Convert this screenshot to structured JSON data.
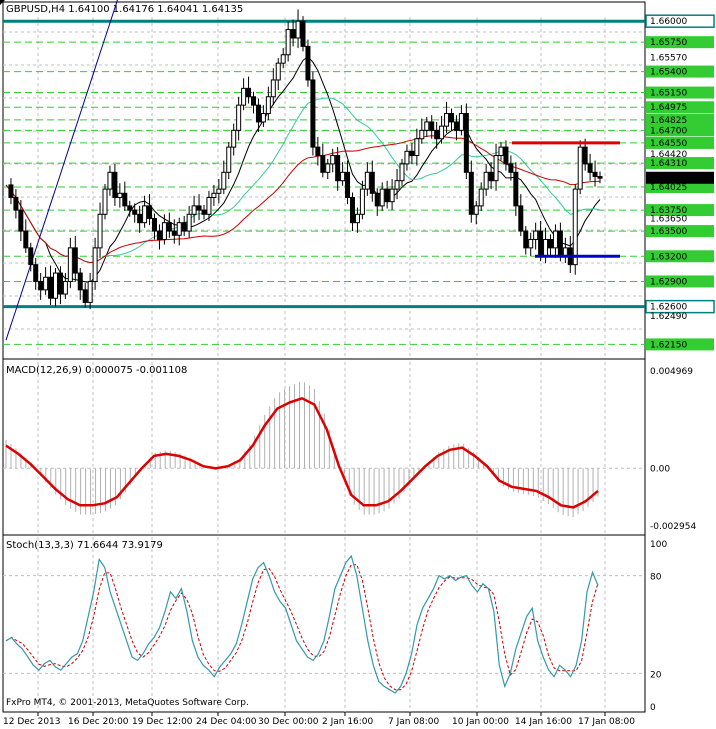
{
  "main": {
    "symbol": "GBPUSD,H4",
    "ohlc": "1.64100 1.64176 1.64041 1.64135",
    "current_price": "1.64135",
    "price_labels": [
      "1.66000",
      "1.65750",
      "1.65570",
      "1.65400",
      "1.65150",
      "1.64975",
      "1.64825",
      "1.64700",
      "1.64550",
      "1.64420",
      "1.64310",
      "1.64025",
      "1.63750",
      "1.63650",
      "1.63500",
      "1.63200",
      "1.62900",
      "1.62600",
      "1.62490",
      "1.62150"
    ],
    "levels": {
      "top_line": "1.66000",
      "bottom_line": "1.62600",
      "resistance": "1.64550",
      "support": "1.63200"
    }
  },
  "macd": {
    "title": "MACD(12,26,9) 0.000075 -0.001108",
    "labels": [
      "0.004969",
      "0.00",
      "-0.002954"
    ]
  },
  "stoch": {
    "title": "Stoch(13,3,3) 71.6644 73.9179",
    "labels": [
      "100",
      "80",
      "20",
      "0"
    ]
  },
  "footer": {
    "copyright": "FxPro MT4, © 2001-2013, MetaQuotes Software Corp."
  },
  "time_axis": [
    "12 Dec 2013",
    "16 Dec 20:00",
    "19 Dec 12:00",
    "24 Dec 04:00",
    "30 Dec 00:00",
    "2 Jan 16:00",
    "7 Jan 08:00",
    "10 Jan 00:00",
    "14 Jan 16:00",
    "17 Jan 08:00"
  ],
  "colors": {
    "grid": "#c0c0c0",
    "fibo": "#33cc33",
    "teal": "#008080",
    "resist": "#dd0000",
    "support": "#0000cc",
    "ma_black": "#000000",
    "ma_red": "#cc0000",
    "ma_green": "#33cc99",
    "ma_blue": "#000099",
    "macd_signal": "#dd0000",
    "stoch_main": "#3399aa",
    "stoch_signal": "#cc0000"
  },
  "chart_data": [
    {
      "type": "candlestick",
      "title": "GBPUSD,H4",
      "ylim": [
        1.62,
        1.6605
      ],
      "x": [
        "12 Dec 2013",
        "16 Dec 20:00",
        "19 Dec 12:00",
        "24 Dec 04:00",
        "30 Dec 00:00",
        "2 Jan 16:00",
        "7 Jan 08:00",
        "10 Jan 00:00",
        "14 Jan 16:00",
        "17 Jan 08:00"
      ],
      "close_path": [
        1.6405,
        1.639,
        1.6375,
        1.635,
        1.633,
        1.631,
        1.629,
        1.628,
        1.6295,
        1.627,
        1.63,
        1.6275,
        1.629,
        1.633,
        1.63,
        1.628,
        1.6265,
        1.629,
        1.633,
        1.637,
        1.64,
        1.642,
        1.639,
        1.6395,
        1.638,
        1.6375,
        1.637,
        1.636,
        1.638,
        1.6365,
        1.635,
        1.634,
        1.636,
        1.635,
        1.6345,
        1.636,
        1.635,
        1.637,
        1.638,
        1.6375,
        1.637,
        1.639,
        1.6395,
        1.64,
        1.642,
        1.645,
        1.647,
        1.65,
        1.652,
        1.651,
        1.65,
        1.648,
        1.649,
        1.651,
        1.653,
        1.655,
        1.656,
        1.659,
        1.658,
        1.66,
        1.657,
        1.653,
        1.645,
        1.644,
        1.642,
        1.643,
        1.644,
        1.641,
        1.642,
        1.639,
        1.636,
        1.637,
        1.64,
        1.642,
        1.6395,
        1.638,
        1.64,
        1.6385,
        1.64,
        1.641,
        1.643,
        1.6445,
        1.644,
        1.646,
        1.647,
        1.648,
        1.647,
        1.646,
        1.6475,
        1.649,
        1.648,
        1.647,
        1.649,
        1.642,
        1.637,
        1.638,
        1.64,
        1.642,
        1.641,
        1.644,
        1.645,
        1.643,
        1.642,
        1.638,
        1.635,
        1.633,
        1.634,
        1.635,
        1.632,
        1.634,
        1.633,
        1.635,
        1.632,
        1.633,
        1.631,
        1.64,
        1.645,
        1.643,
        1.642,
        1.6415,
        1.6413
      ]
    },
    {
      "type": "line",
      "title": "MACD(12,26,9) 0.000075 -0.001108",
      "ylim": [
        -0.00295,
        0.00497
      ],
      "signal": [
        0.0011,
        0.0007,
        0.0002,
        -0.0004,
        -0.001,
        -0.0015,
        -0.0018,
        -0.0018,
        -0.0017,
        -0.0014,
        -0.0007,
        0.0,
        0.0006,
        0.0007,
        0.0006,
        0.0004,
        0.0001,
        0.0,
        0.0001,
        0.0004,
        0.0011,
        0.0021,
        0.0029,
        0.0032,
        0.0034,
        0.0031,
        0.0019,
        0.0001,
        -0.0013,
        -0.0018,
        -0.0018,
        -0.0016,
        -0.0011,
        -0.0005,
        0.0001,
        0.0006,
        0.0009,
        0.001,
        0.0006,
        0.0001,
        -0.0006,
        -0.0009,
        -0.001,
        -0.0011,
        -0.0014,
        -0.0018,
        -0.0019,
        -0.0016,
        -0.0011
      ]
    },
    {
      "type": "line",
      "title": "Stoch(13,3,3) 71.6644 73.9179",
      "ylim": [
        0,
        100
      ],
      "main": [
        40,
        42,
        38,
        35,
        30,
        25,
        22,
        26,
        28,
        24,
        22,
        26,
        30,
        32,
        40,
        55,
        70,
        90,
        85,
        70,
        60,
        50,
        40,
        30,
        28,
        32,
        38,
        42,
        48,
        58,
        70,
        66,
        72,
        58,
        40,
        30,
        25,
        22,
        18,
        24,
        28,
        32,
        38,
        50,
        64,
        78,
        85,
        88,
        80,
        70,
        64,
        60,
        50,
        40,
        35,
        30,
        28,
        32,
        40,
        55,
        72,
        80,
        88,
        92,
        80,
        60,
        40,
        25,
        15,
        12,
        10,
        8,
        12,
        20,
        32,
        50,
        60,
        66,
        72,
        80,
        78,
        80,
        77,
        79,
        80,
        74,
        70,
        75,
        72,
        58,
        25,
        12,
        20,
        35,
        45,
        55,
        60,
        40,
        30,
        22,
        18,
        25,
        22,
        18,
        25,
        40,
        70,
        82,
        74
      ]
    }
  ]
}
